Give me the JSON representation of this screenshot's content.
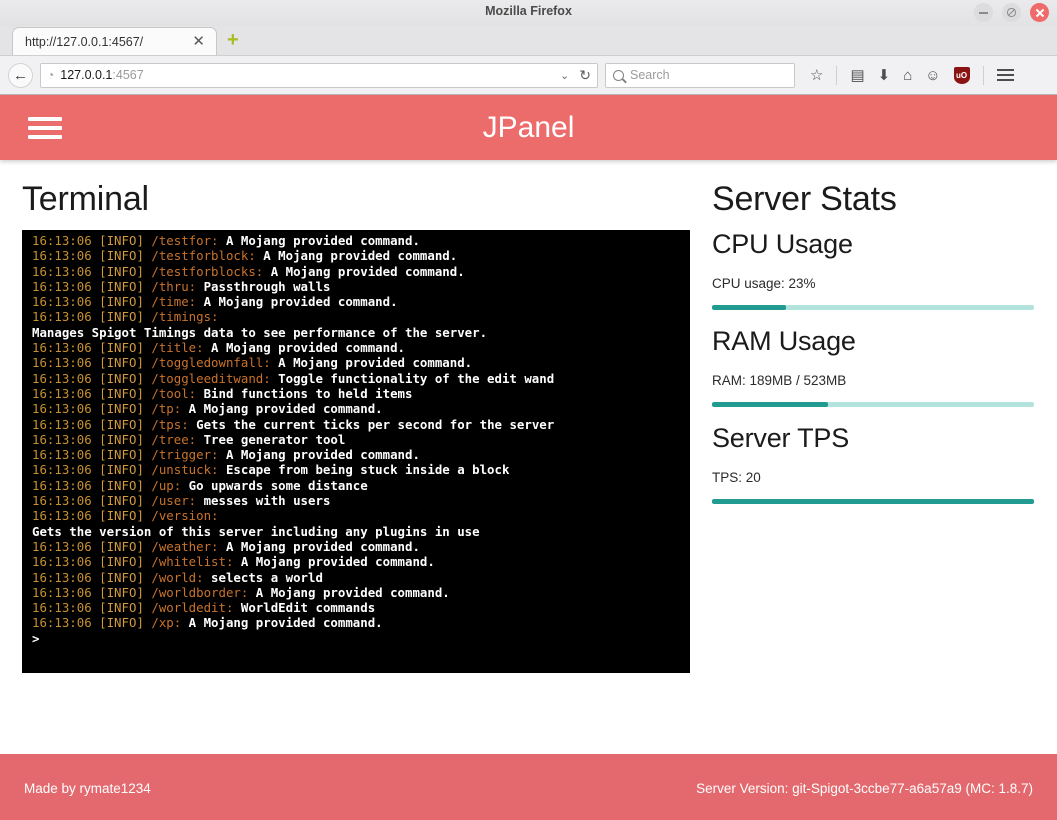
{
  "browser": {
    "window_title": "Mozilla Firefox",
    "tab_title": "http://127.0.0.1:4567/",
    "tab_close_glyph": "✕",
    "new_tab_glyph": "+",
    "back_glyph": "←",
    "url_host": "127.0.0.1",
    "url_port": ":4567",
    "url_dropdown_glyph": "⌄",
    "url_reload_glyph": "↻",
    "globe_glyph": "◔",
    "search_placeholder": "Search",
    "toolbar": {
      "bookmark_glyph": "☆",
      "library_glyph": "▤",
      "download_glyph": "⬇",
      "home_glyph": "⌂",
      "chat_glyph": "☺",
      "ublock_label": "uO"
    }
  },
  "app": {
    "title": "JPanel",
    "nav_toggle_name": "hamburger-menu"
  },
  "terminal": {
    "heading": "Terminal",
    "prompt": ">",
    "lines": [
      {
        "time": "16:13:06",
        "level": "[INFO]",
        "cmd": "/testfor:",
        "desc": "A Mojang provided command."
      },
      {
        "time": "16:13:06",
        "level": "[INFO]",
        "cmd": "/testforblock:",
        "desc": "A Mojang provided command."
      },
      {
        "time": "16:13:06",
        "level": "[INFO]",
        "cmd": "/testforblocks:",
        "desc": "A Mojang provided command."
      },
      {
        "time": "16:13:06",
        "level": "[INFO]",
        "cmd": "/thru:",
        "desc": "Passthrough walls"
      },
      {
        "time": "16:13:06",
        "level": "[INFO]",
        "cmd": "/time:",
        "desc": "A Mojang provided command."
      },
      {
        "time": "16:13:06",
        "level": "[INFO]",
        "cmd": "/timings:",
        "desc": ""
      },
      {
        "continuation": "Manages Spigot Timings data to see performance of the server."
      },
      {
        "time": "16:13:06",
        "level": "[INFO]",
        "cmd": "/title:",
        "desc": "A Mojang provided command."
      },
      {
        "time": "16:13:06",
        "level": "[INFO]",
        "cmd": "/toggledownfall:",
        "desc": "A Mojang provided command."
      },
      {
        "time": "16:13:06",
        "level": "[INFO]",
        "cmd": "/toggleeditwand:",
        "desc": "Toggle functionality of the edit wand"
      },
      {
        "time": "16:13:06",
        "level": "[INFO]",
        "cmd": "/tool:",
        "desc": "Bind functions to held items"
      },
      {
        "time": "16:13:06",
        "level": "[INFO]",
        "cmd": "/tp:",
        "desc": "A Mojang provided command."
      },
      {
        "time": "16:13:06",
        "level": "[INFO]",
        "cmd": "/tps:",
        "desc": "Gets the current ticks per second for the server"
      },
      {
        "time": "16:13:06",
        "level": "[INFO]",
        "cmd": "/tree:",
        "desc": "Tree generator tool"
      },
      {
        "time": "16:13:06",
        "level": "[INFO]",
        "cmd": "/trigger:",
        "desc": "A Mojang provided command."
      },
      {
        "time": "16:13:06",
        "level": "[INFO]",
        "cmd": "/unstuck:",
        "desc": "Escape from being stuck inside a block"
      },
      {
        "time": "16:13:06",
        "level": "[INFO]",
        "cmd": "/up:",
        "desc": "Go upwards some distance"
      },
      {
        "time": "16:13:06",
        "level": "[INFO]",
        "cmd": "/user:",
        "desc": "messes with users"
      },
      {
        "time": "16:13:06",
        "level": "[INFO]",
        "cmd": "/version:",
        "desc": ""
      },
      {
        "continuation": "Gets the version of this server including any plugins in use"
      },
      {
        "time": "16:13:06",
        "level": "[INFO]",
        "cmd": "/weather:",
        "desc": "A Mojang provided command."
      },
      {
        "time": "16:13:06",
        "level": "[INFO]",
        "cmd": "/whitelist:",
        "desc": "A Mojang provided command."
      },
      {
        "time": "16:13:06",
        "level": "[INFO]",
        "cmd": "/world:",
        "desc": "selects a world"
      },
      {
        "time": "16:13:06",
        "level": "[INFO]",
        "cmd": "/worldborder:",
        "desc": "A Mojang provided command."
      },
      {
        "time": "16:13:06",
        "level": "[INFO]",
        "cmd": "/worldedit:",
        "desc": "WorldEdit commands"
      },
      {
        "time": "16:13:06",
        "level": "[INFO]",
        "cmd": "/xp:",
        "desc": "A Mojang provided command."
      }
    ]
  },
  "stats": {
    "heading": "Server Stats",
    "items": [
      {
        "title": "CPU Usage",
        "text": "CPU usage: 23%",
        "percent": 23
      },
      {
        "title": "RAM Usage",
        "text": "RAM: 189MB / 523MB",
        "percent": 36
      },
      {
        "title": "Server TPS",
        "text": "TPS: 20",
        "percent": 100
      }
    ]
  },
  "footer": {
    "made_by": "Made by rymate1234",
    "server_version": "Server Version: git-Spigot-3ccbe77-a6a57a9 (MC: 1.8.7)"
  },
  "colors": {
    "accent_header": "#ec6c6c",
    "accent_footer": "#e3696e",
    "progress_fill": "#219b92",
    "progress_track": "#b2e3dd",
    "terminal_bg": "#000000"
  }
}
